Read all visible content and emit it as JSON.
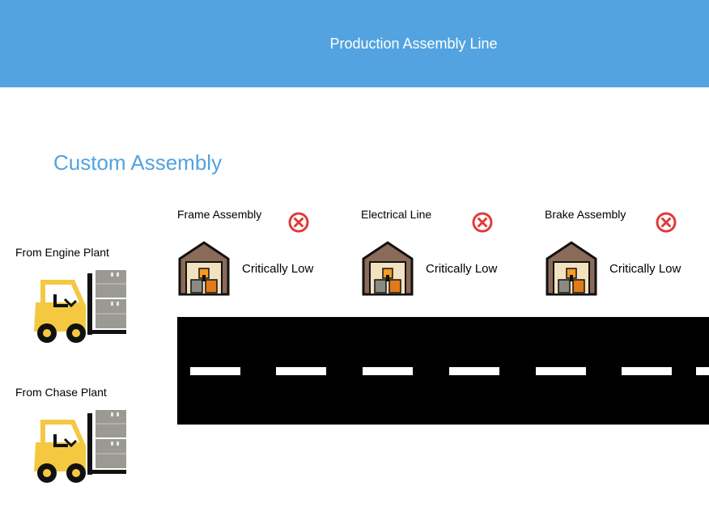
{
  "header": {
    "title": "Production Assembly Line"
  },
  "section": {
    "title": "Custom Assembly"
  },
  "sources": [
    {
      "label": "From Engine Plant"
    },
    {
      "label": "From Chase Plant"
    }
  ],
  "stations": [
    {
      "name": "Frame Assembly",
      "status": "Critically Low",
      "status_icon": "x-circle-icon"
    },
    {
      "name": "Electrical Line",
      "status": "Critically Low",
      "status_icon": "x-circle-icon"
    },
    {
      "name": "Brake Assembly",
      "status": "Critically Low",
      "status_icon": "x-circle-icon"
    }
  ],
  "colors": {
    "header_bg": "#52a3e0",
    "accent": "#52a3e0",
    "error": "#e03a3a",
    "road": "#000000",
    "forklift": "#f5c842"
  }
}
